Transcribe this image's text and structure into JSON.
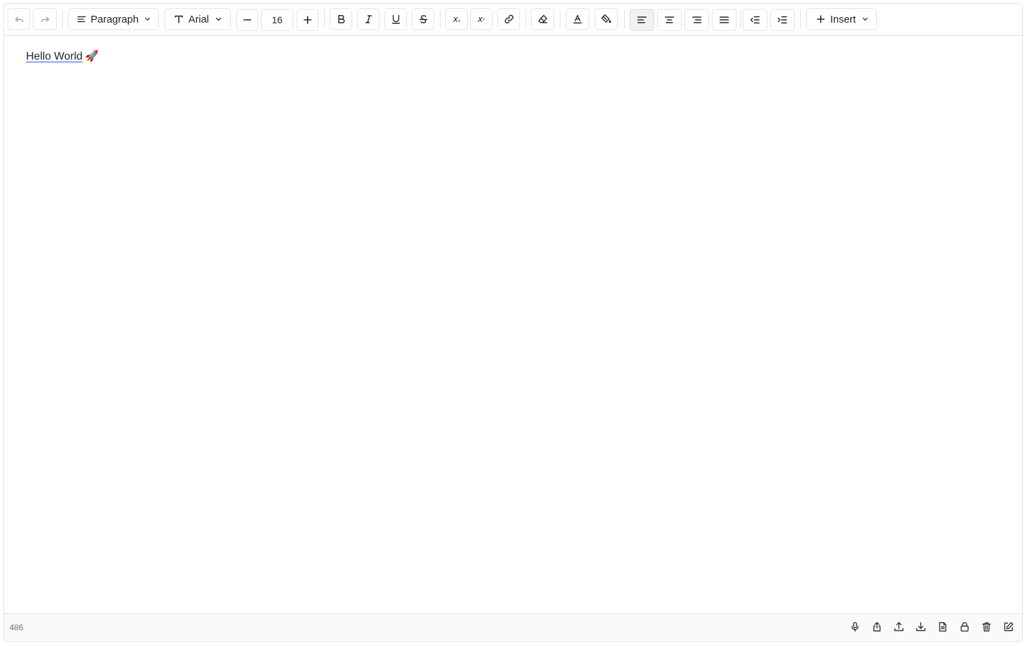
{
  "toolbar": {
    "block_type": "Paragraph",
    "font_family": "Arial",
    "font_size": "16",
    "insert_label": "Insert",
    "active_alignment": "left",
    "undo_disabled": true,
    "redo_disabled": true
  },
  "document": {
    "link_text": "Hello World",
    "emoji": "🚀"
  },
  "status": {
    "count": "486"
  },
  "colors": {
    "border": "#e3e3e6",
    "link_underline": "#2b55d6",
    "active_button_bg": "#f1f1f3"
  }
}
